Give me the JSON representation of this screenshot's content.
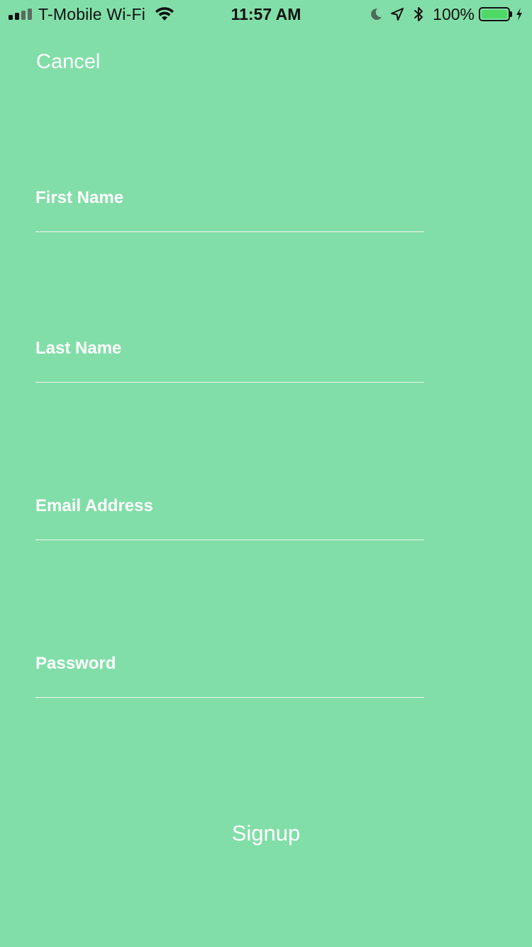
{
  "status_bar": {
    "carrier": "T-Mobile Wi-Fi",
    "time": "11:57 AM",
    "battery_percent": "100%",
    "signal_bars_filled": 2,
    "signal_bars_total": 4,
    "icons": [
      "signal-icon",
      "wifi-icon",
      "moon-icon",
      "location-icon",
      "bluetooth-icon",
      "battery-icon",
      "charging-icon"
    ],
    "battery_color": "#4cd964"
  },
  "nav": {
    "cancel_label": "Cancel"
  },
  "form": {
    "first_name": {
      "label": "First Name",
      "value": ""
    },
    "last_name": {
      "label": "Last Name",
      "value": ""
    },
    "email": {
      "label": "Email Address",
      "value": ""
    },
    "password": {
      "label": "Password",
      "value": ""
    }
  },
  "actions": {
    "signup_label": "Signup"
  },
  "theme": {
    "background": "#82dea8",
    "text": "#ffffff"
  }
}
